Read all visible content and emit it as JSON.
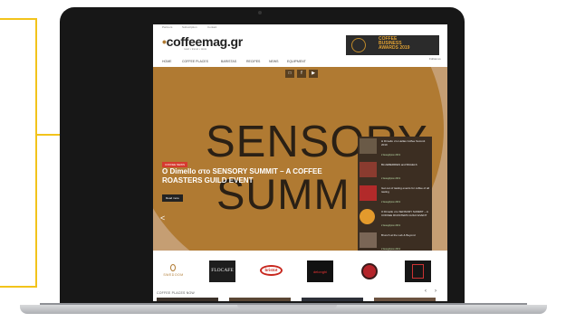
{
  "site": {
    "logo": "coffeemag.gr",
    "tagline": "read • travel • taste",
    "topbar_links": [
      "Partners",
      "Subscription",
      "Contact"
    ],
    "awards_lines": [
      "COFFEE",
      "BUSINESS",
      "AWARDS 2019"
    ],
    "follow_label": "Follow us"
  },
  "nav": [
    "HOME",
    "COFFEE PLACES",
    "BARISTAS",
    "RECIPES",
    "NEWS",
    "EQUIPMENT"
  ],
  "social_icons": [
    "instagram-icon",
    "facebook-icon",
    "youtube-icon"
  ],
  "hero": {
    "background_words": [
      "SENSORY",
      "SUMM"
    ],
    "category": "COFFEE NEWS",
    "title": "O Dimello στο SENSORY SUMMIT – A COFFEE ROASTERS GUILD EVENT",
    "button": "Read more",
    "prev_arrow": "<"
  },
  "sidebar_posts": [
    {
      "title": "Η Dimello στο Hellas Coffee Summit 2019",
      "date": "2 Δεκεμβρίου 2019",
      "thumb_color": "#6a5a47"
    },
    {
      "title": "BLUEBERRIES and BAGELS",
      "date": "2 Δεκεμβρίου 2019",
      "thumb_color": "#8a3b2f"
    },
    {
      "title": "Get out of tasting events for coffee of all tasting",
      "date": "2 Δεκεμβρίου 2019",
      "thumb_color": "#b22a2a"
    },
    {
      "title": "O Dimello στο SENSORY SUMMIT – A COFFEE ROASTERS GUILD EVENT",
      "date": "2 Δεκεμβρίου 2019",
      "thumb_color": "#e39a2c"
    },
    {
      "title": "Brunch at the Lab & Beyond",
      "date": "2 Δεκεμβρίου 2019",
      "thumb_color": "#7a6656"
    }
  ],
  "partners": [
    {
      "name": "SWEDOOM",
      "bg": "#ffffff",
      "fg": "#b07a32"
    },
    {
      "name": "FLOCAFE",
      "bg": "#1d1d1d",
      "fg": "#f0f0f0"
    },
    {
      "name": "bristot",
      "bg": "#ffffff",
      "fg": "#c8281f"
    },
    {
      "name": "delonghi",
      "bg": "#111111",
      "fg": "#e33"
    },
    {
      "name": "",
      "bg": "#ffffff",
      "fg": "#b4242a"
    },
    {
      "name": "",
      "bg": "#161616",
      "fg": "#c33"
    }
  ],
  "coffee_places": {
    "section_title": "COFFEE PLACES NOW",
    "prev": "‹",
    "next": "›"
  },
  "colors": {
    "accent": "#f2c31b",
    "hero_brown": "#b07a32"
  }
}
